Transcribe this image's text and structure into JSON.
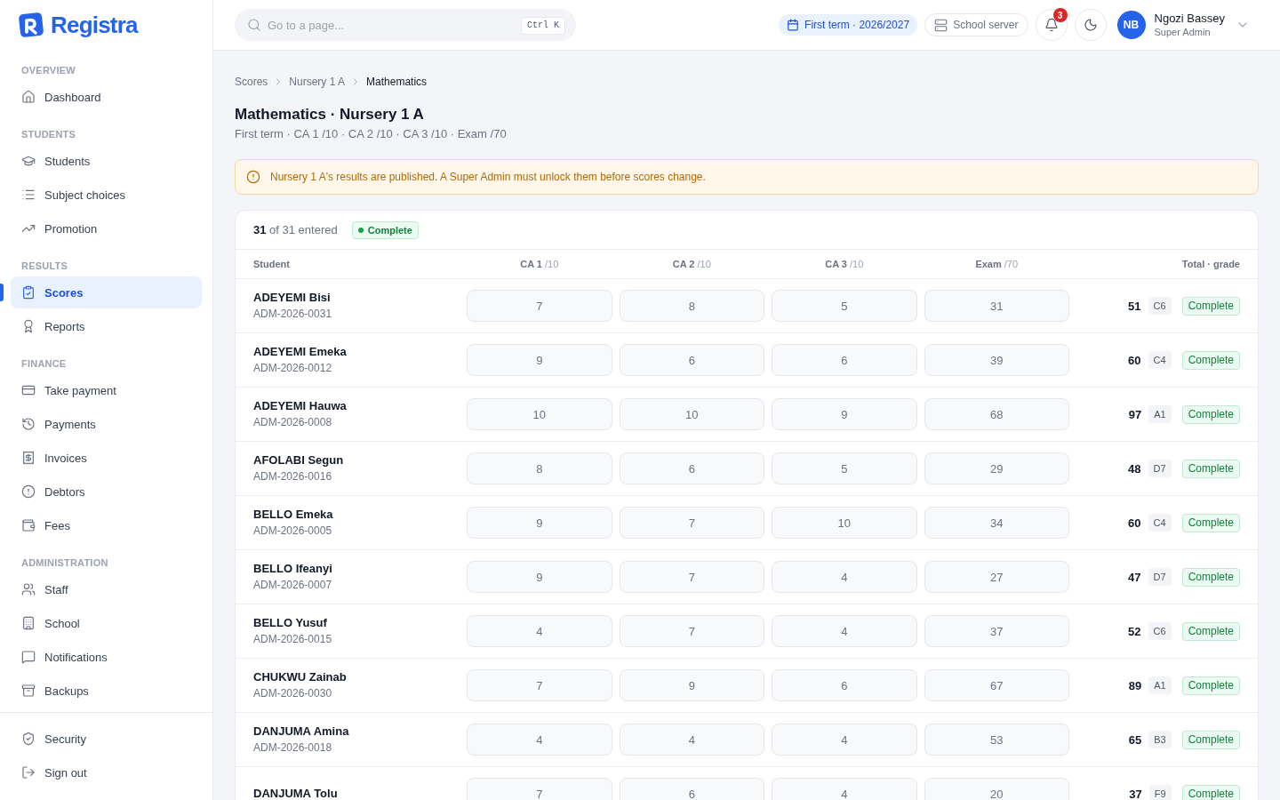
{
  "brand": {
    "name": "Registra"
  },
  "sidebar": {
    "sections": [
      {
        "label": "OVERVIEW",
        "items": [
          {
            "label": "Dashboard",
            "selected": false
          }
        ]
      },
      {
        "label": "STUDENTS",
        "items": [
          {
            "label": "Students",
            "selected": false
          },
          {
            "label": "Subject choices",
            "selected": false
          },
          {
            "label": "Promotion",
            "selected": false
          }
        ]
      },
      {
        "label": "RESULTS",
        "items": [
          {
            "label": "Scores",
            "selected": true
          },
          {
            "label": "Reports",
            "selected": false
          }
        ]
      },
      {
        "label": "FINANCE",
        "items": [
          {
            "label": "Take payment",
            "selected": false
          },
          {
            "label": "Payments",
            "selected": false
          },
          {
            "label": "Invoices",
            "selected": false
          },
          {
            "label": "Debtors",
            "selected": false
          },
          {
            "label": "Fees",
            "selected": false
          }
        ]
      },
      {
        "label": "ADMINISTRATION",
        "items": [
          {
            "label": "Staff",
            "selected": false
          },
          {
            "label": "School",
            "selected": false
          },
          {
            "label": "Notifications",
            "selected": false
          },
          {
            "label": "Backups",
            "selected": false
          }
        ]
      }
    ],
    "bottom_items": [
      {
        "label": "Security",
        "selected": false
      },
      {
        "label": "Sign out",
        "selected": false
      }
    ]
  },
  "topbar": {
    "search": {
      "placeholder": "Go to a page...",
      "shortcut": "Ctrl K"
    },
    "term": "First term · 2026/2027",
    "server": "School server",
    "notifications": {
      "count": "3"
    },
    "user": {
      "initials": "NB",
      "name": "Ngozi Bassey",
      "role": "Super Admin"
    }
  },
  "breadcrumbs": [
    {
      "label": "Scores",
      "current": false
    },
    {
      "label": "Nursery 1 A",
      "current": false
    },
    {
      "label": "Mathematics",
      "current": true
    }
  ],
  "page": {
    "title": "Mathematics · Nursery 1 A",
    "subtitle": "First term · CA 1 /10 · CA 2 /10 · CA 3 /10 · Exam /70"
  },
  "alert": {
    "kind": "warning",
    "text": "Nursery 1 A's results are published. A Super Admin must unlock them before scores change."
  },
  "scores_table": {
    "entered_count": "31",
    "entered_text": "of 31 entered",
    "status": "Complete",
    "locked": true,
    "columns": [
      {
        "label": "Student"
      },
      {
        "label": "CA 1",
        "max": "/10"
      },
      {
        "label": "CA 2",
        "max": "/10"
      },
      {
        "label": "CA 3",
        "max": "/10"
      },
      {
        "label": "Exam",
        "max": "/70"
      },
      {
        "label": "Total · grade"
      }
    ],
    "rows": [
      {
        "name": "ADEYEMI Bisi",
        "id": "ADM-2026-0031",
        "scores": [
          "7",
          "8",
          "5",
          "31"
        ],
        "total": "51",
        "grade": "C6",
        "status": "Complete"
      },
      {
        "name": "ADEYEMI Emeka",
        "id": "ADM-2026-0012",
        "scores": [
          "9",
          "6",
          "6",
          "39"
        ],
        "total": "60",
        "grade": "C4",
        "status": "Complete"
      },
      {
        "name": "ADEYEMI Hauwa",
        "id": "ADM-2026-0008",
        "scores": [
          "10",
          "10",
          "9",
          "68"
        ],
        "total": "97",
        "grade": "A1",
        "status": "Complete"
      },
      {
        "name": "AFOLABI Segun",
        "id": "ADM-2026-0016",
        "scores": [
          "8",
          "6",
          "5",
          "29"
        ],
        "total": "48",
        "grade": "D7",
        "status": "Complete"
      },
      {
        "name": "BELLO Emeka",
        "id": "ADM-2026-0005",
        "scores": [
          "9",
          "7",
          "10",
          "34"
        ],
        "total": "60",
        "grade": "C4",
        "status": "Complete"
      },
      {
        "name": "BELLO Ifeanyi",
        "id": "ADM-2026-0007",
        "scores": [
          "9",
          "7",
          "4",
          "27"
        ],
        "total": "47",
        "grade": "D7",
        "status": "Complete"
      },
      {
        "name": "BELLO Yusuf",
        "id": "ADM-2026-0015",
        "scores": [
          "4",
          "7",
          "4",
          "37"
        ],
        "total": "52",
        "grade": "C6",
        "status": "Complete"
      },
      {
        "name": "CHUKWU Zainab",
        "id": "ADM-2026-0030",
        "scores": [
          "7",
          "9",
          "6",
          "67"
        ],
        "total": "89",
        "grade": "A1",
        "status": "Complete"
      },
      {
        "name": "DANJUMA Amina",
        "id": "ADM-2026-0018",
        "scores": [
          "4",
          "4",
          "4",
          "53"
        ],
        "total": "65",
        "grade": "B3",
        "status": "Complete"
      },
      {
        "name": "DANJUMA Tolu",
        "scores": [
          "7",
          "6",
          "4",
          "20"
        ],
        "total": "37",
        "grade": "F9",
        "status": "Complete"
      }
    ]
  }
}
